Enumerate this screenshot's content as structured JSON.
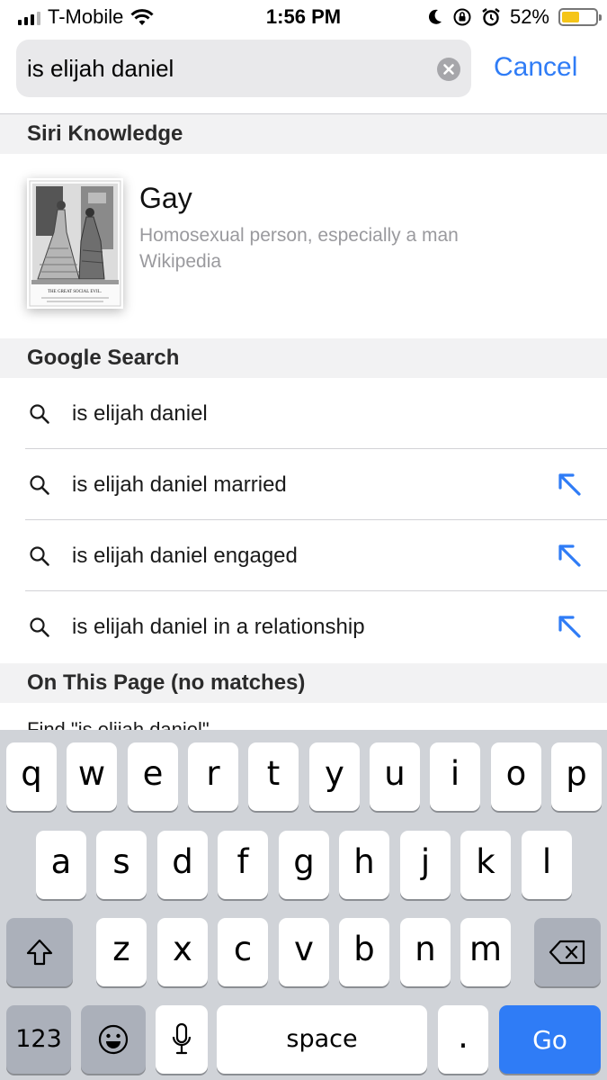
{
  "status_bar": {
    "carrier": "T-Mobile",
    "time": "1:56 PM",
    "battery": "52%",
    "battery_level": 0.52
  },
  "search": {
    "query": "is elijah daniel",
    "cancel_label": "Cancel"
  },
  "siri_knowledge": {
    "header": "Siri Knowledge",
    "title": "Gay",
    "subtitle": "Homosexual person, especially a man",
    "source": "Wikipedia",
    "thumbnail_caption": "THE GREAT SOCIAL EVIL."
  },
  "google_search": {
    "header": "Google Search",
    "suggestions": [
      {
        "label": "is elijah daniel",
        "has_arrow": false
      },
      {
        "label": "is elijah daniel married",
        "has_arrow": true
      },
      {
        "label": "is elijah daniel engaged",
        "has_arrow": true
      },
      {
        "label": "is elijah daniel in a relationship",
        "has_arrow": true
      }
    ]
  },
  "on_this_page": {
    "header": "On This Page (no matches)",
    "partial_row": "Find \"is elijah daniel\""
  },
  "keyboard": {
    "row1": [
      "q",
      "w",
      "e",
      "r",
      "t",
      "y",
      "u",
      "i",
      "o",
      "p"
    ],
    "row2": [
      "a",
      "s",
      "d",
      "f",
      "g",
      "h",
      "j",
      "k",
      "l"
    ],
    "row3": [
      "z",
      "x",
      "c",
      "v",
      "b",
      "n",
      "m"
    ],
    "numbers_label": "123",
    "space_label": "space",
    "period_label": ".",
    "go_label": "Go"
  },
  "colors": {
    "accent": "#2f7cf6",
    "battery": "#f5c518",
    "keyboard_bg": "#d0d3d8",
    "section_bg": "#f2f2f3"
  }
}
